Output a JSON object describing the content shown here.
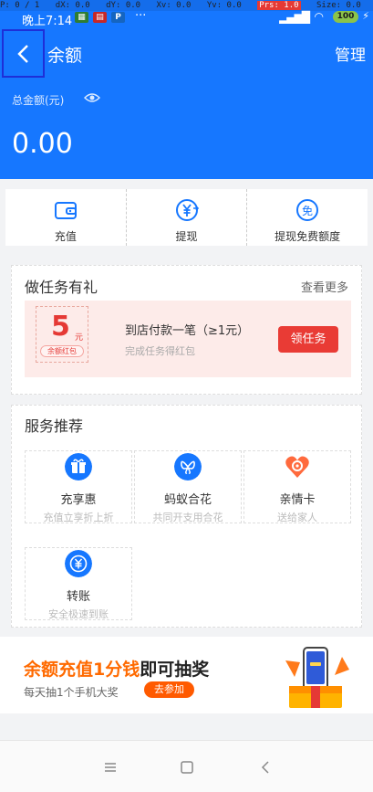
{
  "debug": {
    "p": "P: 0 / 1",
    "dx": "dX: 0.0",
    "dy": "dY: 0.0",
    "xv": "Xv: 0.0",
    "yv": "Yv: 0.0",
    "prs": "Prs: 1.0",
    "size": "Size: 0.0"
  },
  "status_bar": {
    "time": "晚上7:14",
    "dots": "···",
    "battery": "100"
  },
  "header": {
    "title": "余额",
    "manage_label": "管理"
  },
  "balance": {
    "label": "总金额(元)",
    "amount": "0.00"
  },
  "quick_actions": [
    {
      "label": "充值",
      "icon": "wallet-icon"
    },
    {
      "label": "提现",
      "icon": "withdraw-icon"
    },
    {
      "label": "提现免费额度",
      "icon": "free-icon"
    }
  ],
  "quick_free_glyph": "免",
  "task": {
    "title": "做任务有礼",
    "more": "查看更多",
    "coupon_value": "5",
    "coupon_unit": "元",
    "coupon_tag": "余额红包",
    "line1": "到店付款一笔（≥1元）",
    "line2": "完成任务得红包",
    "button": "领任务"
  },
  "services": {
    "title": "服务推荐",
    "items": [
      {
        "name": "充享惠",
        "desc": "充值立享折上折",
        "icon": "gift-icon",
        "color": "#1677ff"
      },
      {
        "name": "蚂蚁合花",
        "desc": "共同开支用合花",
        "icon": "butterfly-icon",
        "color": "#1677ff"
      },
      {
        "name": "亲情卡",
        "desc": "送给家人",
        "icon": "heart-icon",
        "color": "#ff6a3d"
      },
      {
        "name": "转账",
        "desc": "安全极速到账",
        "icon": "transfer-icon",
        "color": "#1677ff"
      }
    ]
  },
  "banner": {
    "headline_orange": "余额充值1分钱",
    "headline_dark": "即可抽奖",
    "sub": "每天抽1个手机大奖",
    "button": "去参加"
  },
  "colors": {
    "brand_blue": "#1677ff",
    "task_red": "#e93b35",
    "banner_orange": "#ff6a00"
  }
}
